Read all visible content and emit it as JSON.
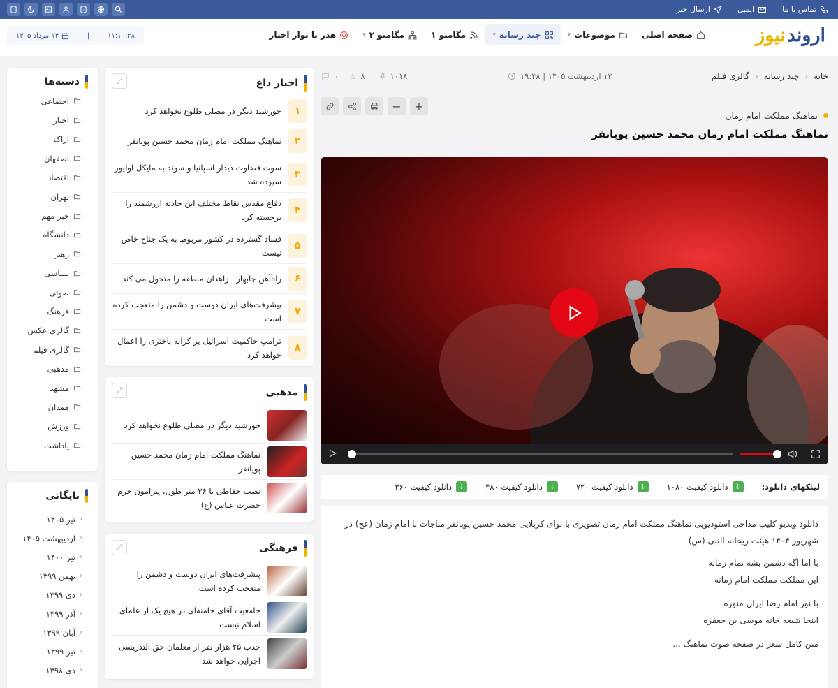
{
  "topbar": {
    "contact": "تماس با ما",
    "email": "ایمیل",
    "send_news": "ارسال خبر"
  },
  "logo": {
    "part1": "اروند",
    "part2": "نیوز"
  },
  "nav": {
    "home": "صفحه اصلی",
    "topics": "موضوعات",
    "multimedia": "چند رسانه",
    "megamenu1": "مگامنو ۱",
    "megamenu2": "مگامنو ۲",
    "header_ticker": "هدر با نوار اخبار"
  },
  "clock": {
    "time": "۱۱:۱۰:۲۸",
    "date": "۱۴ مرداد ۱۴۰۵"
  },
  "categories": {
    "title": "دسته‌ها",
    "items": [
      "اجتماعی",
      "اخبار",
      "اراک",
      "اصفهان",
      "اقتصاد",
      "تهران",
      "خبر مهم",
      "دانشگاه",
      "رهبر",
      "سیاسی",
      "صوتی",
      "فرهنگ",
      "گالری عکس",
      "گالری فیلم",
      "مذهبی",
      "مشهد",
      "همدان",
      "ورزش",
      "یاداشت"
    ]
  },
  "archive": {
    "title": "بایگانی",
    "items": [
      "تیر ۱۴۰۵",
      "اردیبهشت ۱۴۰۵",
      "تیر ۱۴۰۰",
      "بهمن ۱۳۹۹",
      "دی ۱۳۹۹",
      "آذر ۱۳۹۹",
      "آبان ۱۳۹۹",
      "تیر ۱۳۹۹",
      "دی ۱۳۹۸"
    ]
  },
  "hot": {
    "title": "اخبار داغ",
    "items": [
      {
        "n": "۱",
        "t": "خورشید دیگر در مصلی طلوع نخواهد کرد"
      },
      {
        "n": "۲",
        "t": "نماهنگ مملکت امام زمان محمد حسین پویانفر"
      },
      {
        "n": "۳",
        "t": "سوت قضاوت دیدار اسپانیا و سوئد به مایکل اولیور سپرده شد"
      },
      {
        "n": "۴",
        "t": "دفاع مقدس نقاط مختلف این حادثه ارزشمند را برجسته کرد"
      },
      {
        "n": "۵",
        "t": "فساد گسترده در کشور مربوط به یک جناح خاص نیست"
      },
      {
        "n": "۶",
        "t": "راه‌آهن چابهار ـ زاهدان منطقه را متحول می کند"
      },
      {
        "n": "۷",
        "t": "پیشرفت‌های ایران دوست و دشمن را متعجب کرده است"
      },
      {
        "n": "۸",
        "t": "ترامپ حاکمیت اسرائیل بر کرانه باختری را اعمال خواهد کرد"
      }
    ]
  },
  "religious": {
    "title": "مذهبی",
    "items": [
      "خورشید دیگر در مصلی طلوع نخواهد کرد",
      "نماهنگ مملکت امام زمان محمد حسین پویانفر",
      "نصب حفاظی با ۳۶ متر طول، پیرامون حرم حضرت عباس (ع)"
    ]
  },
  "cultural": {
    "title": "فرهنگی",
    "items": [
      "پیشرفت‌های ایران دوست و دشمن را متعجب کرده است",
      "جامعیت آقای خامنه‌ای در هیچ یک از علمای اسلام نیست",
      "جذب ۲۵ هزار نفر از معلمان حق التدریسی اجرایی خواهد شد"
    ]
  },
  "breadcrumb": {
    "home": "خانه",
    "multimedia": "چند رسانه",
    "film_gallery": "گالری فیلم"
  },
  "meta": {
    "date": "۱۳ اردیبهشت ۱۴۰۵ | ۱۹:۴۸",
    "id": "۱۰۱۸",
    "likes": "۸",
    "comments": "۰"
  },
  "article": {
    "subtitle": "نماهنگ مملکت امام زمان",
    "title": "نماهنگ مملکت امام زمان محمد حسین پویانفر",
    "downloads_label": "لینکهای دانلود:",
    "downloads": [
      "دانلود کیفیت ۱۰۸۰",
      "دانلود کیفیت ۷۲۰",
      "دانلود کیفیت ۴۸۰",
      "دانلود کیفیت ۳۶۰"
    ],
    "paragraph": "دانلود ویدیو کلیپ مداحی استودیویی نماهنگ مملکت امام زمان تصویری با نوای کربلایی محمد حسین پویانفر مناجات با امام زمان (عج) در شهریور ۱۴۰۴ هیئت ریحانه النبی (س)",
    "verse1a": "با اما اگه دشمن بشه تمام زمانه",
    "verse1b": "این مملکت مملکت امام زمانه",
    "verse2a": "با نور امام رضا ایران منوره",
    "verse2b": "اینجا شیعه خانه موسی بن جعفره",
    "more": "متن کامل شعر در صفحه صوت نماهنگ ..."
  },
  "colors": {
    "primary": "#3a5a9c",
    "accent": "#f0b400",
    "play": "#e30613",
    "download": "#4caf50"
  }
}
